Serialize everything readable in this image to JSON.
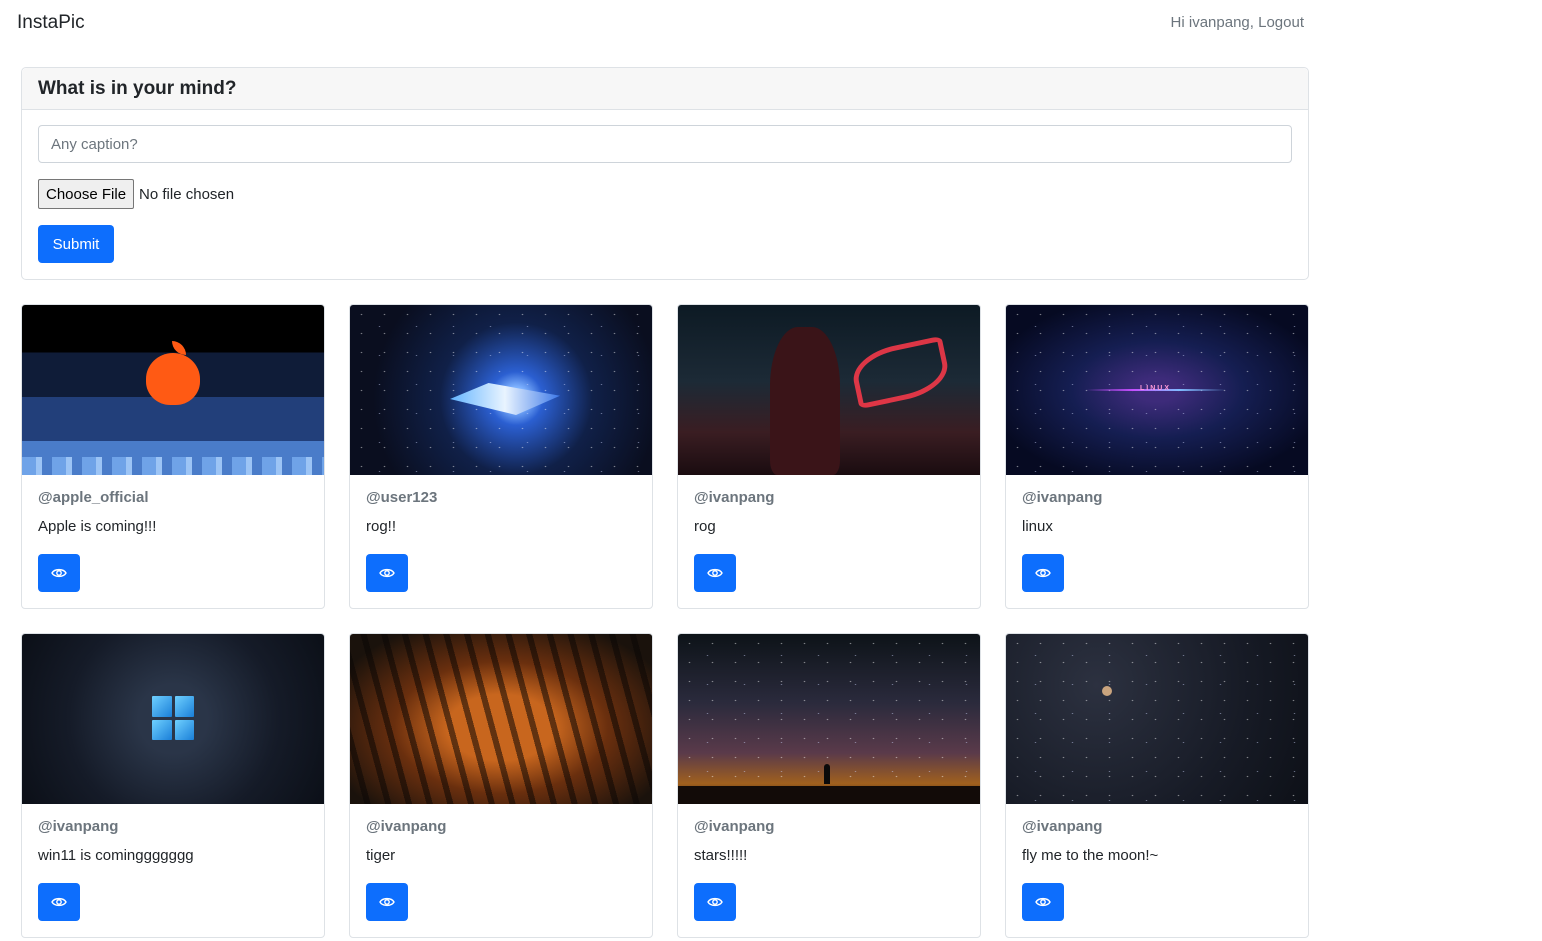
{
  "navbar": {
    "brand": "InstaPic",
    "greeting": "Hi ivanpang,",
    "logout": "Logout"
  },
  "post_form": {
    "title": "What is in your mind?",
    "caption_placeholder": "Any caption?",
    "choose_file_label": "Choose File",
    "file_status": "No file chosen",
    "submit_label": "Submit"
  },
  "posts": [
    {
      "user": "@apple_official",
      "caption": "Apple is coming!!!",
      "image": "apple-logo-wallpaper"
    },
    {
      "user": "@user123",
      "caption": "rog!!",
      "image": "rog-city-wallpaper"
    },
    {
      "user": "@ivanpang",
      "caption": "rog",
      "image": "rog-hooded-person-wallpaper"
    },
    {
      "user": "@ivanpang",
      "caption": "linux",
      "image": "linux-galaxy-wallpaper"
    },
    {
      "user": "@ivanpang",
      "caption": "win11 is cominggggggg",
      "image": "windows11-logo-wallpaper"
    },
    {
      "user": "@ivanpang",
      "caption": "tiger",
      "image": "tiger-face-photo"
    },
    {
      "user": "@ivanpang",
      "caption": "stars!!!!!",
      "image": "milky-way-photo"
    },
    {
      "user": "@ivanpang",
      "caption": "fly me to the moon!~",
      "image": "moon-starry-sky-photo"
    }
  ],
  "icons": {
    "view": "eye-icon"
  },
  "colors": {
    "primary": "#0d6efd",
    "muted": "#6c757d",
    "border": "#dee2e6"
  }
}
